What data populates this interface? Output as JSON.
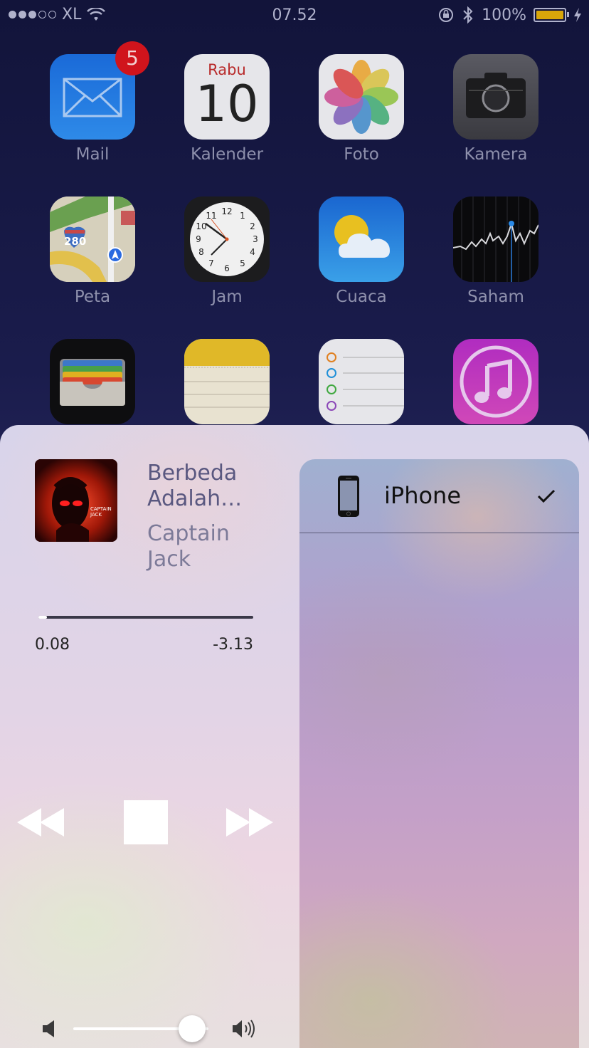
{
  "status_bar": {
    "carrier": "XL",
    "time": "07.52",
    "battery": "100%"
  },
  "apps": [
    {
      "label": "Mail",
      "badge": "5"
    },
    {
      "label": "Kalender",
      "day_name": "Rabu",
      "day_number": "10"
    },
    {
      "label": "Foto"
    },
    {
      "label": "Kamera"
    },
    {
      "label": "Peta",
      "road_sign": "280"
    },
    {
      "label": "Jam"
    },
    {
      "label": "Cuaca"
    },
    {
      "label": "Saham"
    },
    {
      "label": ""
    },
    {
      "label": ""
    },
    {
      "label": ""
    },
    {
      "label": ""
    }
  ],
  "now_playing": {
    "title": "Berbeda Adalah…",
    "artist": "Captain Jack",
    "art_text": "CAPTAIN JACK",
    "elapsed": "0.08",
    "remaining": "-3.13",
    "progress_fraction": 0.03,
    "volume_fraction": 0.88
  },
  "route": {
    "device": "iPhone",
    "selected": true
  }
}
